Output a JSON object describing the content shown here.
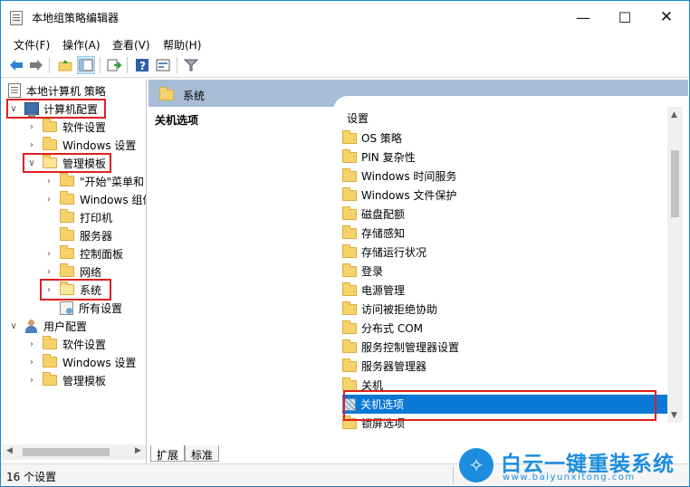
{
  "window": {
    "title": "本地组策略编辑器"
  },
  "menu": [
    "文件(F)",
    "操作(A)",
    "查看(V)",
    "帮助(H)"
  ],
  "toolbar_icons": [
    "back-arrow-icon",
    "forward-arrow-icon",
    "up-folder-icon",
    "show-hide-tree-icon",
    "export-list-icon",
    "help-icon",
    "properties-icon",
    "filter-icon"
  ],
  "tree": {
    "root": "本地计算机 策略",
    "computer_config": "计算机配置",
    "software_settings": "软件设置",
    "windows_settings": "Windows 设置",
    "admin_templates": "管理模板",
    "start_menu": "\"开始\"菜单和",
    "windows_components": "Windows 组件",
    "printers": "打印机",
    "servers": "服务器",
    "control_panel": "控制面板",
    "network": "网络",
    "system": "系统",
    "all_settings": "所有设置",
    "user_config": "用户配置",
    "user_software_settings": "软件设置",
    "user_windows_settings": "Windows 设置",
    "user_admin_templates": "管理模板"
  },
  "right": {
    "header": "系统",
    "description_title": "关机选项",
    "column_header": "设置",
    "items": [
      "OS 策略",
      "PIN 复杂性",
      "Windows 时间服务",
      "Windows 文件保护",
      "磁盘配额",
      "存储感知",
      "存储运行状况",
      "登录",
      "电源管理",
      "访问被拒绝协助",
      "分布式 COM",
      "服务控制管理器设置",
      "服务器管理器",
      "关机",
      "关机选项",
      "锁屏选项"
    ],
    "selected_index": 14
  },
  "tabs": [
    "扩展",
    "标准"
  ],
  "status": "16 个设置",
  "watermark": {
    "title": "白云一键重装系统",
    "url": "www.baiyunxitong.com"
  },
  "colors": {
    "selection": "#0a78d7",
    "header_band": "#a7bdd6",
    "highlight_box": "#e02020",
    "brand": "#1d8de0"
  }
}
